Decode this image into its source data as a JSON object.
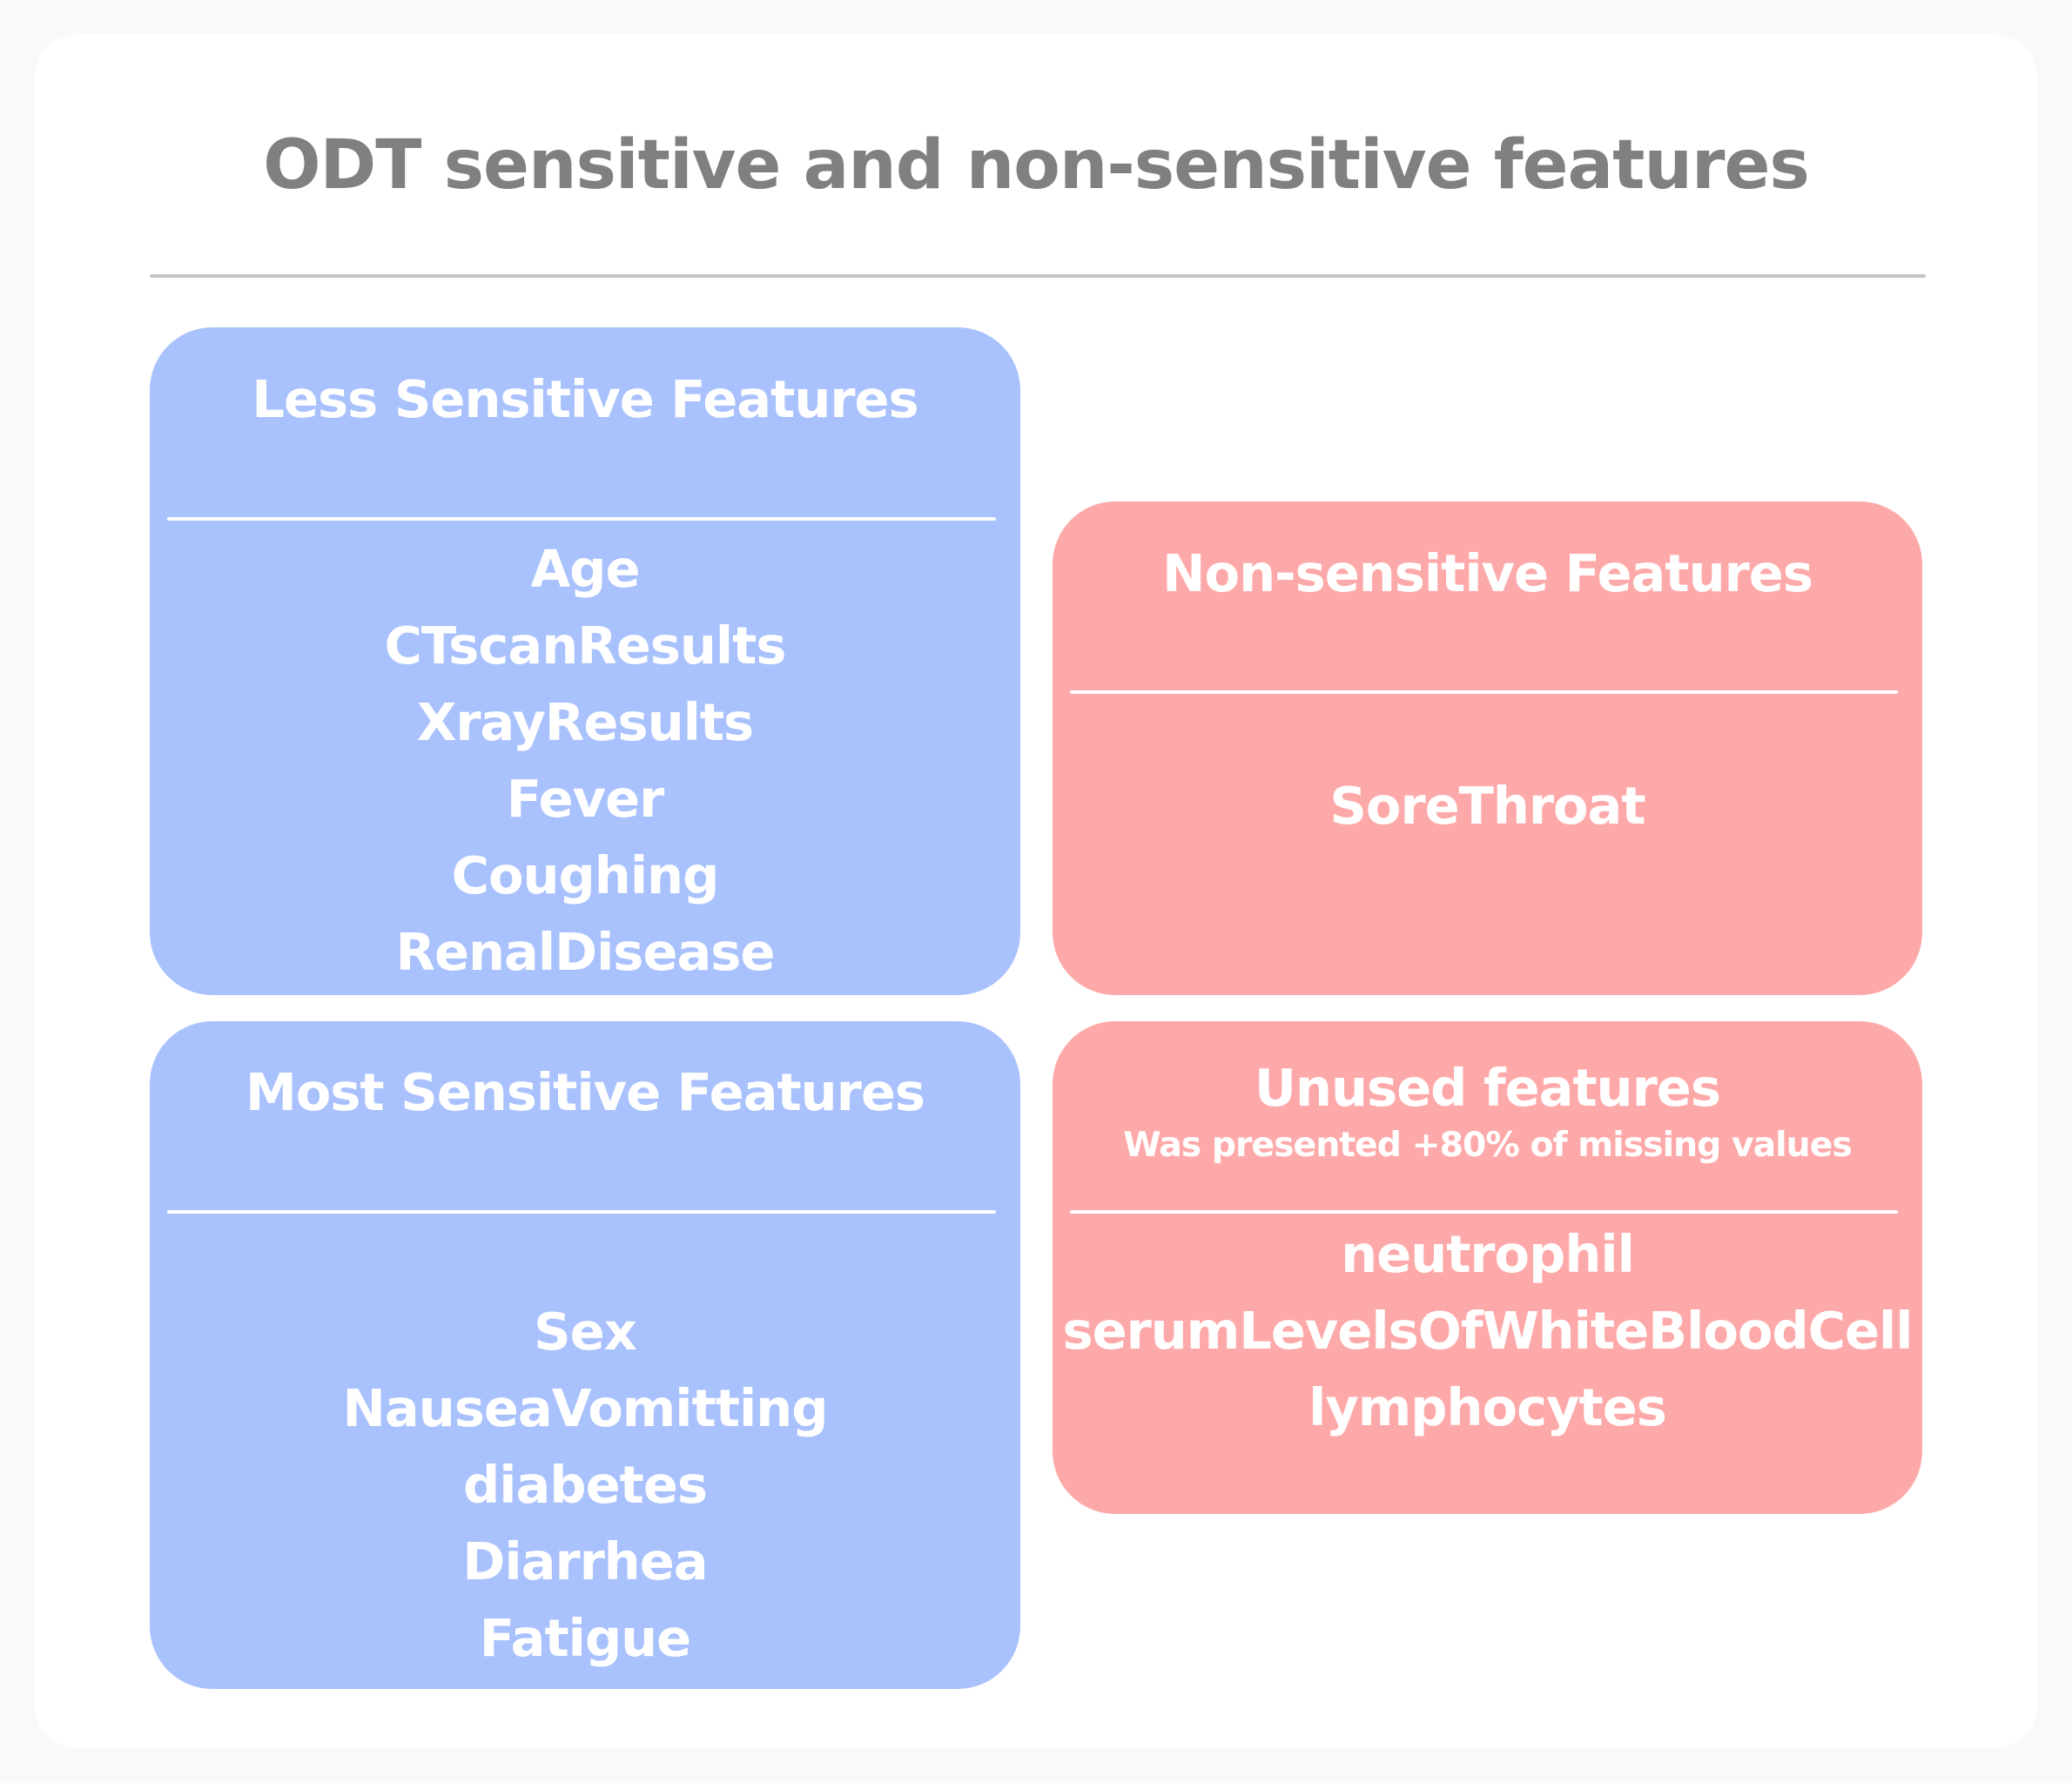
{
  "title": "ODT sensitive and non-sensitive features",
  "colors": {
    "title": "#808080",
    "divider": "#c4c4c4",
    "sensitive_box": "#a9c1fc",
    "non_sensitive_box": "#fea9a9",
    "text_on_box": "#ffffff",
    "background": "#f9f9f9",
    "card": "#ffffff"
  },
  "boxes": {
    "less_sensitive": {
      "heading": "Less Sensitive Features",
      "items": [
        "Age",
        "CTscanResults",
        "XrayResults",
        "Fever",
        "Coughing",
        "RenalDisease"
      ]
    },
    "most_sensitive": {
      "heading": "Most Sensitive Features",
      "items": [
        "Sex",
        "NauseaVomitting",
        "diabetes",
        "Diarrhea",
        "Fatigue"
      ]
    },
    "non_sensitive": {
      "heading": "Non-sensitive Features",
      "items": [
        "SoreThroat"
      ]
    },
    "unused": {
      "heading": "Unused features",
      "subheading": "Was presented +80% of missing values",
      "items": [
        "neutrophil",
        "serumLevelsOfWhiteBloodCell",
        "lymphocytes"
      ]
    }
  }
}
